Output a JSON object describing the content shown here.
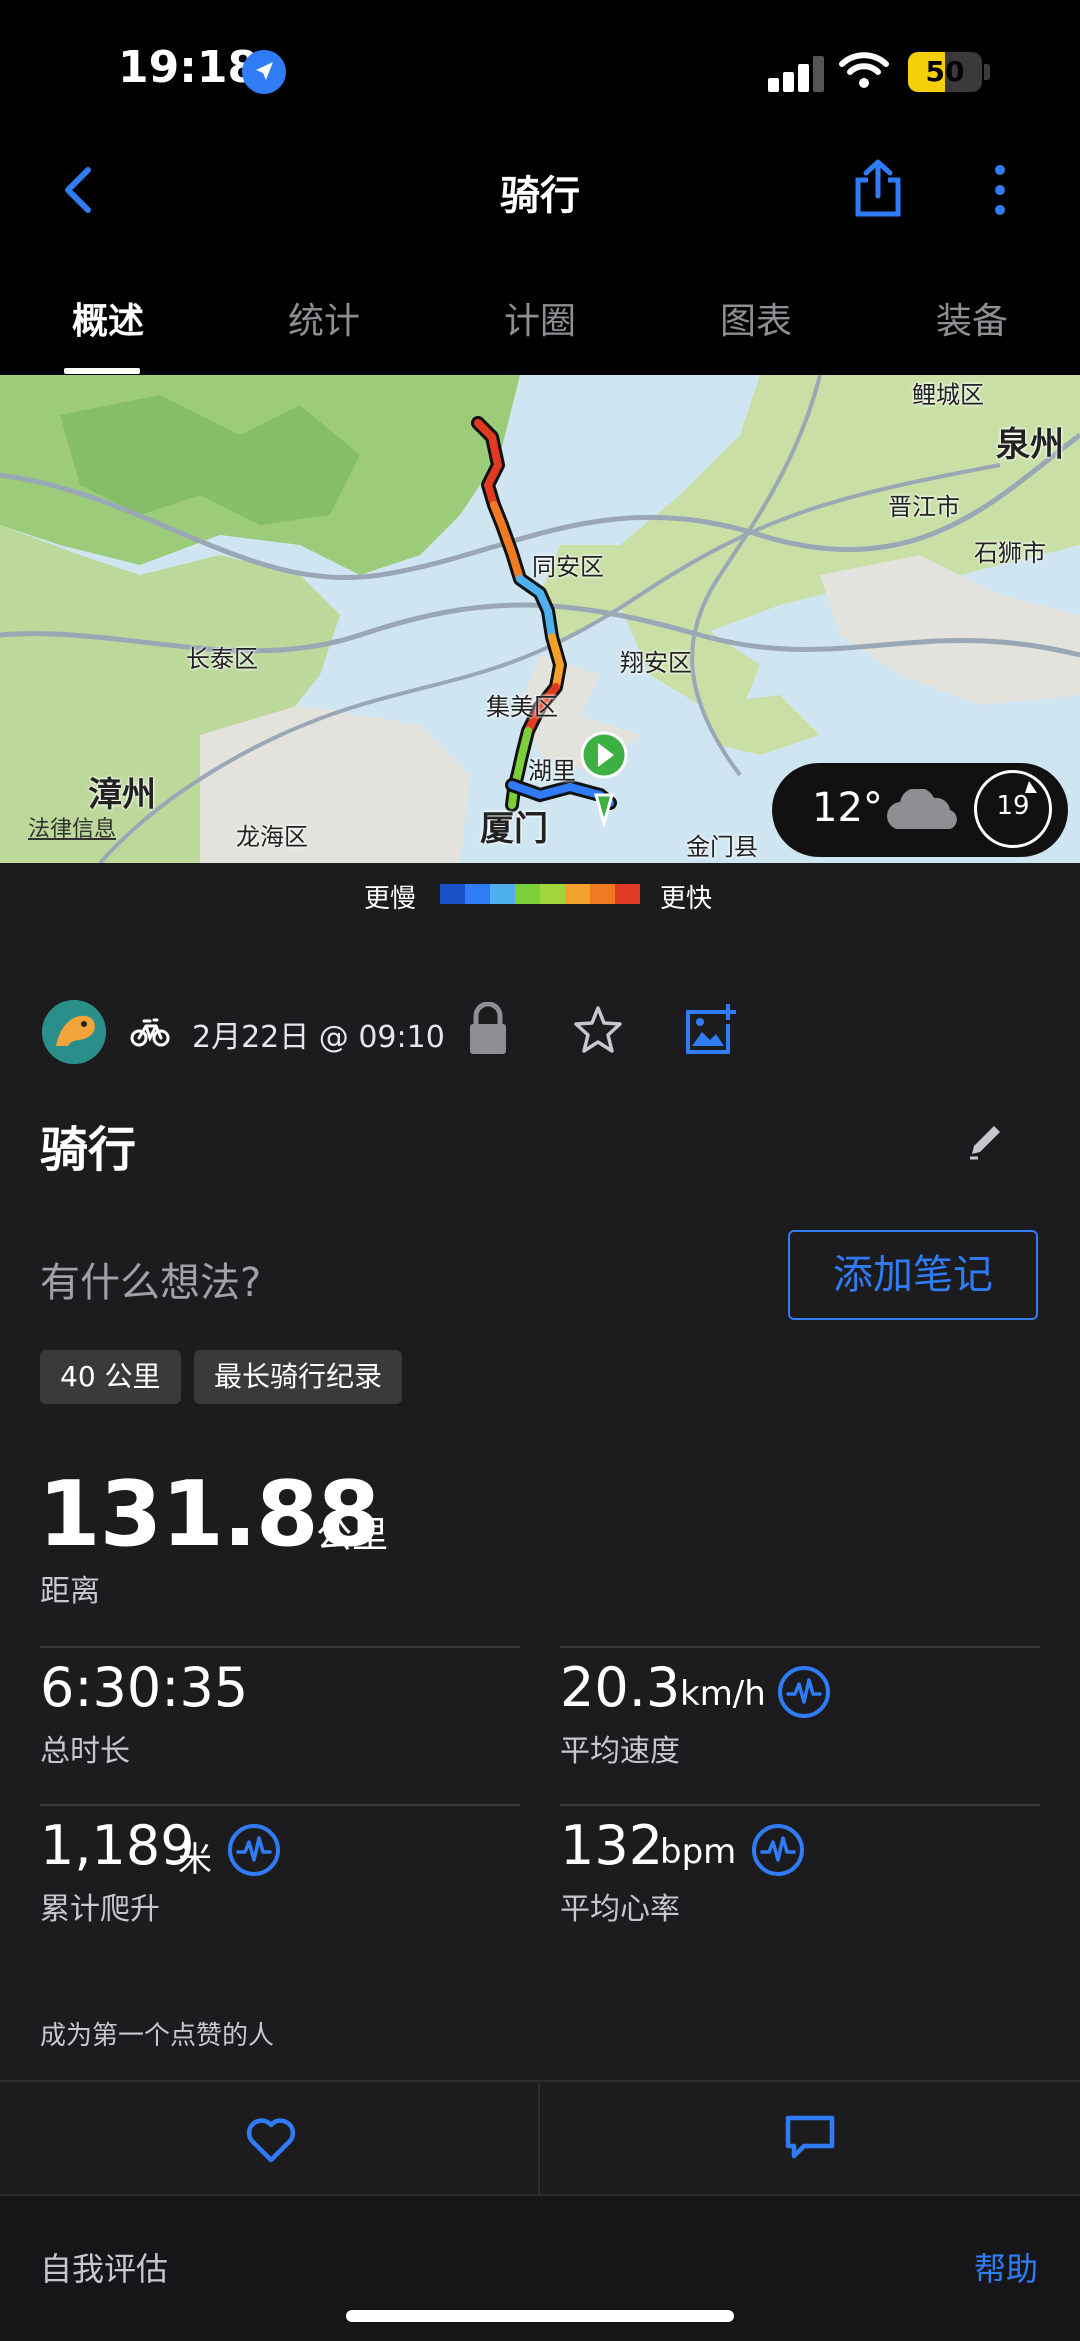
{
  "status_bar": {
    "time": "19:18",
    "battery": "50",
    "battery_level": 0.5
  },
  "header": {
    "title": "骑行",
    "back_icon": "chevron-left-icon",
    "share_icon": "share-icon",
    "more_icon": "more-vertical-icon"
  },
  "tabs": [
    {
      "label": "概述",
      "active": true
    },
    {
      "label": "统计",
      "active": false
    },
    {
      "label": "计圈",
      "active": false
    },
    {
      "label": "图表",
      "active": false
    },
    {
      "label": "装备",
      "active": false
    }
  ],
  "map": {
    "labels": {
      "quanzhou": "泉州",
      "jinjiang": "晋江市",
      "shishi": "石狮市",
      "licheng": "鲤城区",
      "tongan": "同安区",
      "changtai": "长泰区",
      "xiangan": "翔安区",
      "jimei": "集美区",
      "zhangzhou": "漳州",
      "huli": "湖里",
      "xiamen": "厦门",
      "longhai": "龙海区",
      "jinmen": "金门县"
    },
    "legal": "法律信息",
    "weather": {
      "temp": "12°",
      "icon": "cloud-icon",
      "wind": "19"
    }
  },
  "legend": {
    "slower": "更慢",
    "faster": "更快",
    "colors": [
      "#1c52c8",
      "#2f7cf6",
      "#4fb0f0",
      "#7ccf3a",
      "#a0d63c",
      "#f3a12b",
      "#f07a22",
      "#e03a22"
    ]
  },
  "activity": {
    "date": "2月22日 @ 09:10",
    "title": "骑行",
    "thoughts_placeholder": "有什么想法?",
    "add_note": "添加笔记",
    "badges": [
      "40 公里",
      "最长骑行纪录"
    ]
  },
  "stats": {
    "distance": {
      "value": "131.88",
      "unit": "公里",
      "label": "距离"
    },
    "duration": {
      "value": "6:30:35",
      "label": "总时长"
    },
    "avg_speed": {
      "value": "20.3",
      "unit": "km/h",
      "label": "平均速度"
    },
    "ascent": {
      "value": "1,189",
      "unit": "米",
      "label": "累计爬升"
    },
    "avg_hr": {
      "value": "132",
      "unit": "bpm",
      "label": "平均心率"
    }
  },
  "social": {
    "first_like": "成为第一个点赞的人"
  },
  "footer": {
    "self_eval": "自我评估",
    "help": "帮助"
  },
  "accent_color": "#2f7cf6"
}
